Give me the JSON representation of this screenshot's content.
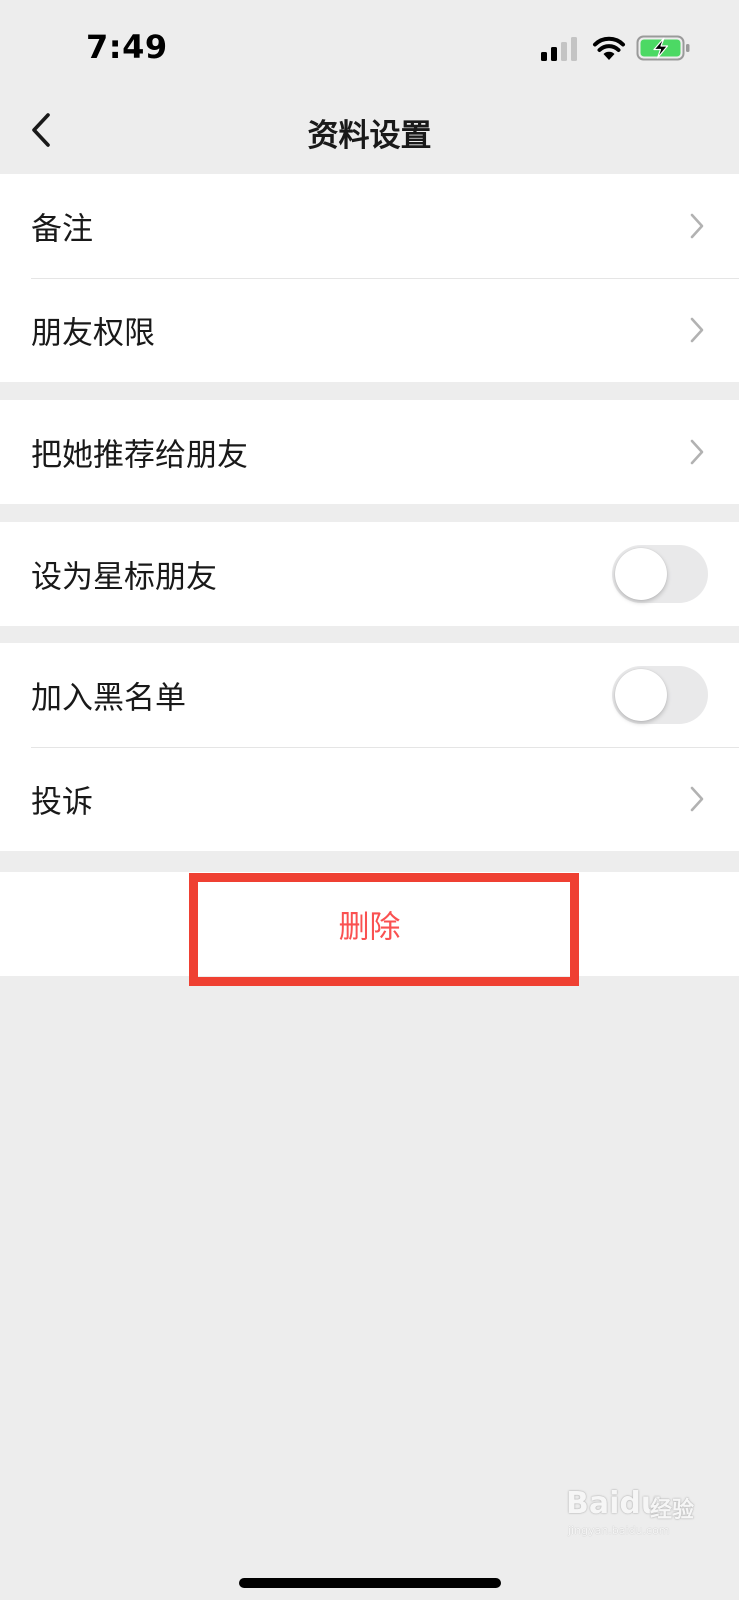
{
  "status_bar": {
    "time": "7:49",
    "icons": [
      "signal-icon",
      "wifi-icon",
      "battery-charging-icon"
    ],
    "battery_color": "#4cd964"
  },
  "nav": {
    "title": "资料设置",
    "back_icon": "chevron-left-icon"
  },
  "groups": [
    {
      "items": [
        {
          "label": "备注",
          "accessory": "chevron"
        },
        {
          "label": "朋友权限",
          "accessory": "chevron"
        }
      ]
    },
    {
      "items": [
        {
          "label": "把她推荐给朋友",
          "accessory": "chevron"
        }
      ]
    },
    {
      "items": [
        {
          "label": "设为星标朋友",
          "accessory": "toggle",
          "on": false
        }
      ]
    },
    {
      "items": [
        {
          "label": "加入黑名单",
          "accessory": "toggle",
          "on": false
        },
        {
          "label": "投诉",
          "accessory": "chevron"
        }
      ]
    }
  ],
  "delete_button": {
    "label": "删除",
    "color": "#fa5151",
    "highlight_color": "#ef4032"
  },
  "watermark": {
    "brand": "Baidu",
    "cn": "经验",
    "url": "jingyan.baidu.com"
  }
}
